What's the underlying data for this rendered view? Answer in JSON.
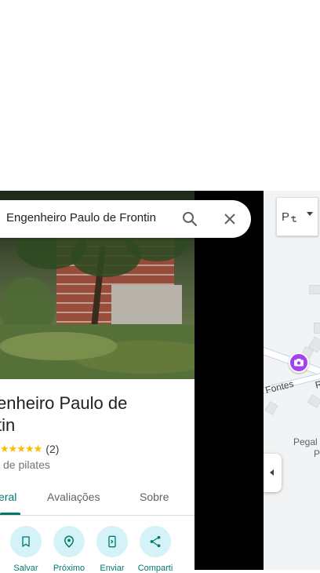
{
  "search": {
    "query": "Engenheiro Paulo de Frontin"
  },
  "place": {
    "title_line1": "enheiro Paulo de",
    "title_line2": "tin",
    "stars": "★★★★★",
    "review_count": "(2)",
    "category": "de pilates"
  },
  "tabs": [
    {
      "label": "eral",
      "active": true
    },
    {
      "label": "Avaliações",
      "active": false
    },
    {
      "label": "Sobre",
      "active": false
    }
  ],
  "actions": [
    {
      "label": "Salvar",
      "icon": "bookmark-icon"
    },
    {
      "label": "Próximo",
      "icon": "nearby-icon"
    },
    {
      "label": "Enviar",
      "icon": "send-to-phone-icon"
    },
    {
      "label": "Comparti",
      "icon": "share-icon"
    }
  ],
  "map": {
    "layer_label": "P",
    "street_label": "Fontes",
    "street_label_2": "R",
    "place_label_line1": "Pegal",
    "place_label_line2": "P"
  },
  "colors": {
    "accent": "#00796b",
    "action_bg": "#d4f2f7",
    "star": "#fbbc04",
    "pin": "#a142f4"
  }
}
